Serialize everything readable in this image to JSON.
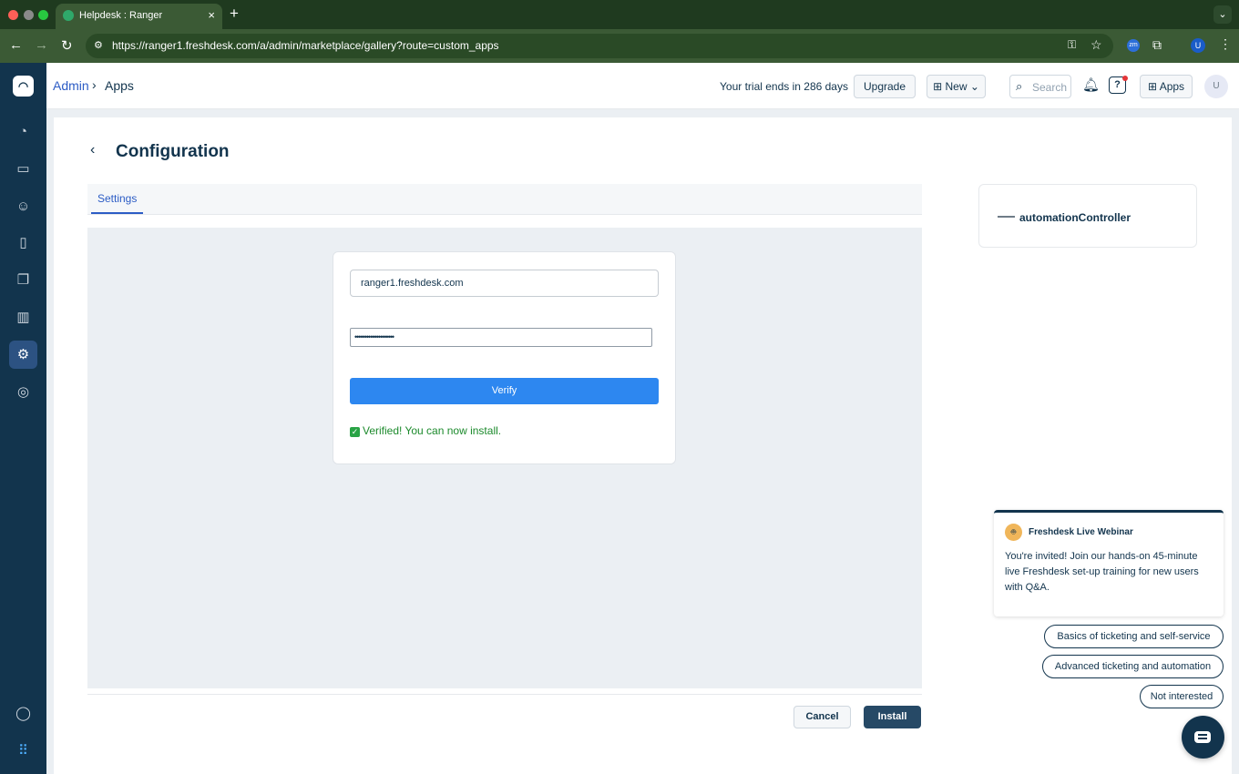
{
  "browser": {
    "tab_title": "Helpdesk : Ranger",
    "tab_close": "×",
    "new_tab": "+",
    "url": "https://ranger1.freshdesk.com/a/admin/marketplace/gallery?route=custom_apps",
    "profile_initial": "U",
    "zm_ext": "zm"
  },
  "header": {
    "breadcrumb_admin": "Admin",
    "breadcrumb_sep": "›",
    "breadcrumb_apps": "Apps",
    "trial_text": "Your trial ends in 286 days",
    "upgrade_label": "Upgrade",
    "new_label": "New",
    "search_placeholder": "Search",
    "apps_label": "Apps",
    "help_label": "?",
    "avatar_initial": "U"
  },
  "page": {
    "title": "Configuration",
    "tab_settings": "Settings",
    "domain_value": "ranger1.freshdesk.com",
    "password_masked": "••••••••••••••••••••",
    "verify_label": "Verify",
    "verified_message": "Verified! You can now install.",
    "cancel_label": "Cancel",
    "install_label": "Install",
    "app_name": "automationController"
  },
  "webinar": {
    "title": "Freshdesk Live Webinar",
    "message": "You're invited! Join our hands-on 45-minute live Freshdesk set-up training for new users with Q&A.",
    "options": [
      "Basics of ticketing and self-service",
      "Advanced ticketing and automation",
      "Not interested"
    ]
  },
  "colors": {
    "sidebar": "#12344d",
    "accent": "#2c5cc5",
    "verify_button": "#2d87f0",
    "install_button": "#264966",
    "verified_text": "#1c8a2c"
  }
}
